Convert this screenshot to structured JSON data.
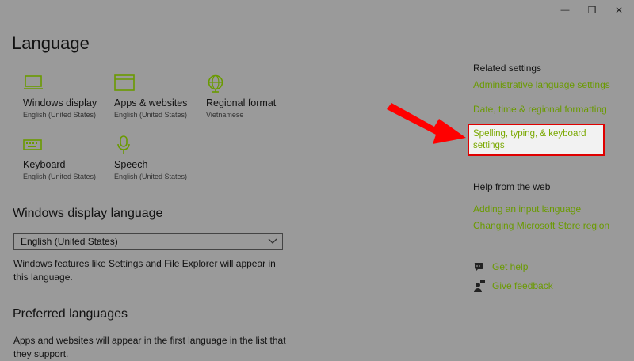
{
  "window": {
    "minimize_glyph": "—",
    "maximize_glyph": "❐",
    "close_glyph": "✕"
  },
  "page": {
    "title": "Language"
  },
  "tiles": [
    {
      "label": "Windows display",
      "sub": "English (United States)",
      "icon": "monitor-icon"
    },
    {
      "label": "Apps & websites",
      "sub": "English (United States)",
      "icon": "browser-window-icon"
    },
    {
      "label": "Regional format",
      "sub": "Vietnamese",
      "icon": "globe-icon"
    },
    {
      "label": "Keyboard",
      "sub": "English (United States)",
      "icon": "keyboard-icon"
    },
    {
      "label": "Speech",
      "sub": "English (United States)",
      "icon": "microphone-icon"
    }
  ],
  "display_language": {
    "heading": "Windows display language",
    "selected": "English (United States)",
    "description": "Windows features like Settings and File Explorer will appear in this language."
  },
  "preferred": {
    "heading": "Preferred languages",
    "description": "Apps and websites will appear in the first language in the list that they support."
  },
  "related": {
    "heading": "Related settings",
    "links": [
      "Administrative language settings",
      "Date, time & regional formatting",
      "Spelling, typing, & keyboard settings"
    ]
  },
  "help_web": {
    "heading": "Help from the web",
    "links": [
      "Adding an input language",
      "Changing Microsoft Store region"
    ]
  },
  "help_actions": [
    {
      "label": "Get help",
      "icon": "chat-bubble-icon"
    },
    {
      "label": "Give feedback",
      "icon": "feedback-person-icon"
    }
  ],
  "colors": {
    "background": "#9a9a9a",
    "accent_link": "#6a9a00",
    "highlight_border": "#e00000",
    "arrow": "#ff0000"
  }
}
